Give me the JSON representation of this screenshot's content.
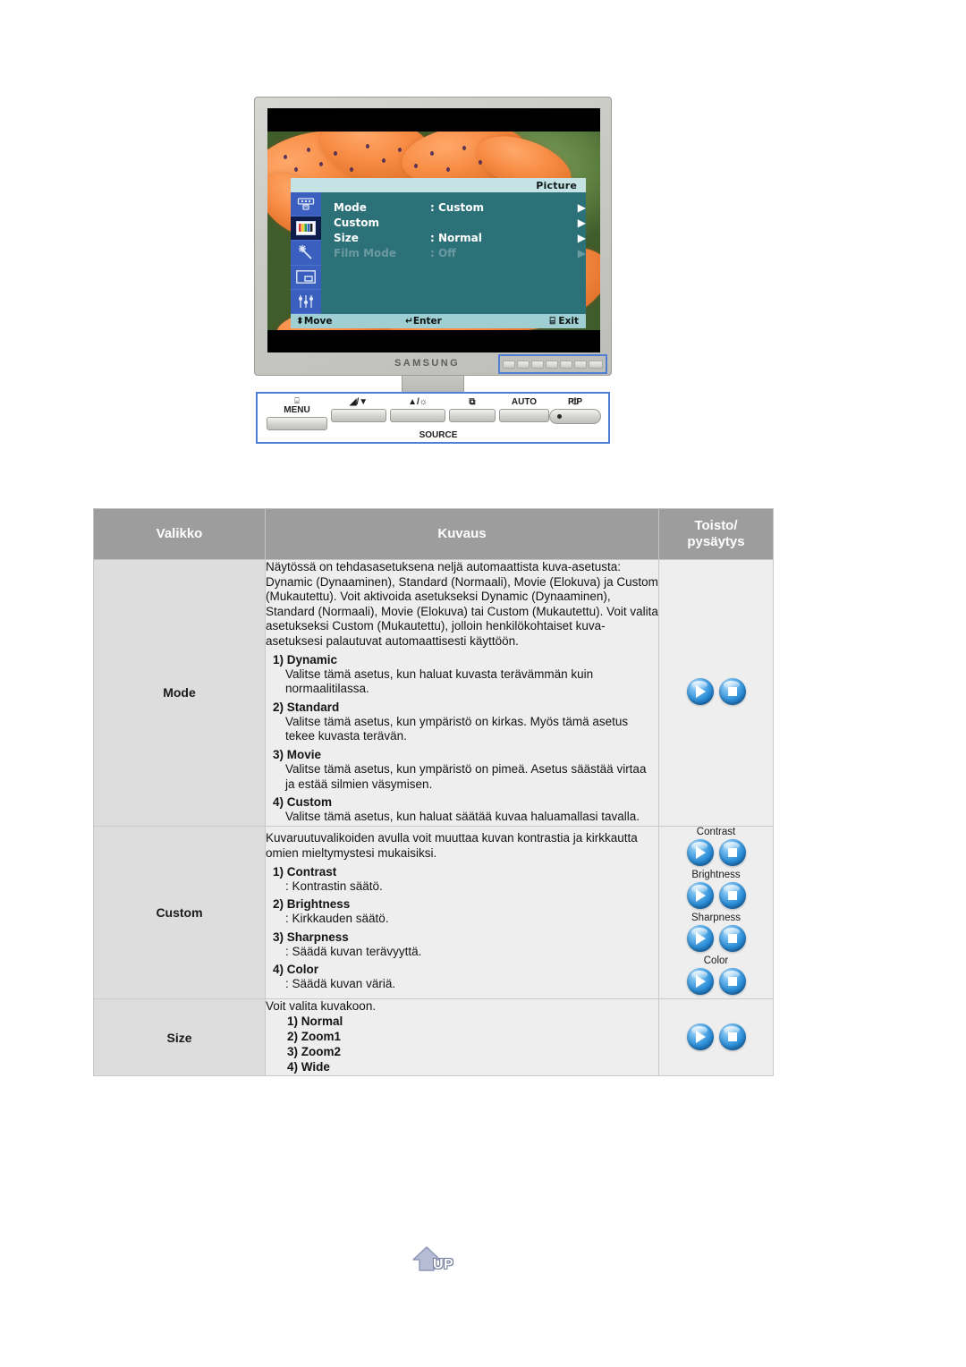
{
  "monitor": {
    "brand": "SAMSUNG",
    "osd": {
      "title": "Picture",
      "sidebar_icons": [
        "input-source-icon",
        "picture-color-bars-icon",
        "magic-wand-icon",
        "pip-icon",
        "setup-sliders-icon"
      ],
      "rows": [
        {
          "label": "Mode",
          "value": ": Custom",
          "arrow": "▶",
          "disabled": false
        },
        {
          "label": "Custom",
          "value": "",
          "arrow": "▶",
          "disabled": false
        },
        {
          "label": "Size",
          "value": ": Normal",
          "arrow": "▶",
          "disabled": false
        },
        {
          "label": "Film Mode",
          "value": ": Off",
          "arrow": "▶",
          "disabled": true
        }
      ],
      "footer": {
        "move": "Move",
        "move_glyph": "⬍",
        "enter": "Enter",
        "enter_glyph": "↵",
        "exit": "Exit",
        "exit_glyph": "⌸"
      }
    },
    "controls": [
      {
        "glyph": "⌸",
        "label": "MENU"
      },
      {
        "glyph": "",
        "label": "◢/▼"
      },
      {
        "glyph": "",
        "label": "▲/☼"
      },
      {
        "glyph": "",
        "label": "⧉"
      },
      {
        "glyph": "",
        "label": "AUTO"
      },
      {
        "glyph": "",
        "label": "PIP"
      }
    ],
    "source_label": "SOURCE",
    "power_label": "⏻"
  },
  "table": {
    "headers": {
      "menu": "Valikko",
      "description": "Kuvaus",
      "playstop_line1": "Toisto/",
      "playstop_line2": "pysäytys"
    },
    "rows": [
      {
        "menu": "Mode",
        "intro": "Näytössä on tehdasasetuksena neljä automaattista kuva-asetusta: Dynamic (Dynaaminen), Standard (Normaali), Movie (Elokuva) ja Custom (Mukautettu). Voit aktivoida asetukseksi Dynamic (Dynaaminen), Standard (Normaali), Movie (Elokuva) tai Custom (Mukautettu). Voit valita asetukseksi Custom (Mukautettu), jolloin henkilökohtaiset kuva-asetuksesi palautuvat automaattisesti käyttöön.",
        "items": [
          {
            "head": "1) Dynamic",
            "body": "Valitse tämä asetus, kun haluat kuvasta terävämmän kuin normaalitilassa."
          },
          {
            "head": "2) Standard",
            "body": "Valitse tämä asetus, kun ympäristö on kirkas. Myös tämä asetus tekee kuvasta terävän."
          },
          {
            "head": "3) Movie",
            "body": "Valitse tämä asetus, kun ympäristö on pimeä. Asetus säästää virtaa ja estää silmien väsymisen."
          },
          {
            "head": "4) Custom",
            "body": "Valitse tämä asetus, kun haluat säätää kuvaa haluamallasi tavalla."
          }
        ],
        "buttons": [
          {
            "caption": "",
            "play": "play-icon",
            "stop": "stop-icon"
          }
        ]
      },
      {
        "menu": "Custom",
        "intro": "Kuvaruutuvalikoiden avulla voit muuttaa kuvan kontrastia ja kirkkautta omien mieltymystesi mukaisiksi.",
        "items": [
          {
            "head": "1) Contrast",
            "body": ": Kontrastin säätö."
          },
          {
            "head": "2) Brightness",
            "body": ": Kirkkauden säätö."
          },
          {
            "head": "3) Sharpness",
            "body": ": Säädä kuvan terävyyttä."
          },
          {
            "head": "4) Color",
            "body": ": Säädä kuvan väriä."
          }
        ],
        "buttons": [
          {
            "caption": "Contrast",
            "play": "play-icon",
            "stop": "stop-icon"
          },
          {
            "caption": "Brightness",
            "play": "play-icon",
            "stop": "stop-icon"
          },
          {
            "caption": "Sharpness",
            "play": "play-icon",
            "stop": "stop-icon"
          },
          {
            "caption": "Color",
            "play": "play-icon",
            "stop": "stop-icon"
          }
        ]
      },
      {
        "menu": "Size",
        "intro": "Voit valita kuvakoon.",
        "items": [
          {
            "head": "1) Normal",
            "body": ""
          },
          {
            "head": "2) Zoom1",
            "body": ""
          },
          {
            "head": "3) Zoom2",
            "body": ""
          },
          {
            "head": "4) Wide",
            "body": ""
          }
        ],
        "buttons": [
          {
            "caption": "",
            "play": "play-icon",
            "stop": "stop-icon"
          }
        ]
      }
    ]
  },
  "up_button": {
    "label": "UP",
    "icon": "up-arrow-icon"
  },
  "colors": {
    "header_bg": "#9d9d9d",
    "menu_cell_bg": "#dddddd",
    "desc_cell_bg": "#eeeeee",
    "osd_panel": "#2c7078",
    "osd_sidebar": "#3a5fbe",
    "osd_title_bar": "#c5e3e4",
    "osd_footer": "#9fcfd2",
    "callout_border": "#4f7fd4",
    "button_blue": "#2e8fd8"
  }
}
